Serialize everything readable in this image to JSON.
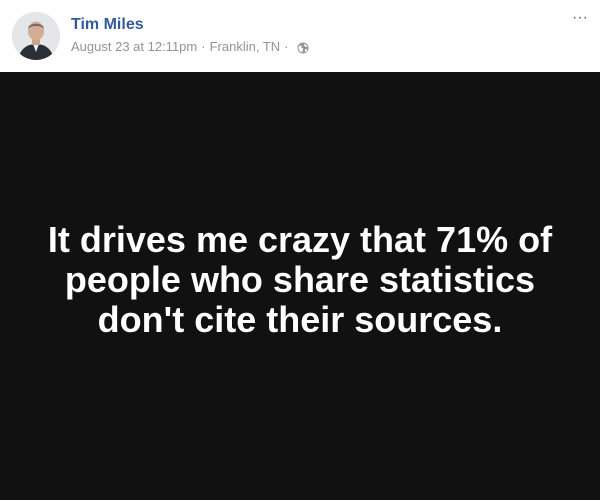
{
  "post": {
    "author_name": "Tim Miles",
    "timestamp": "August 23 at 12:11pm",
    "separator": "·",
    "location": "Franklin, TN",
    "audience_icon": "globe-icon",
    "more_label": "···",
    "content_text": "It drives me crazy that 71% of people who share statistics don't cite their sources.",
    "content_background": "#111111",
    "content_text_color": "#ffffff",
    "author_color": "#365899"
  }
}
